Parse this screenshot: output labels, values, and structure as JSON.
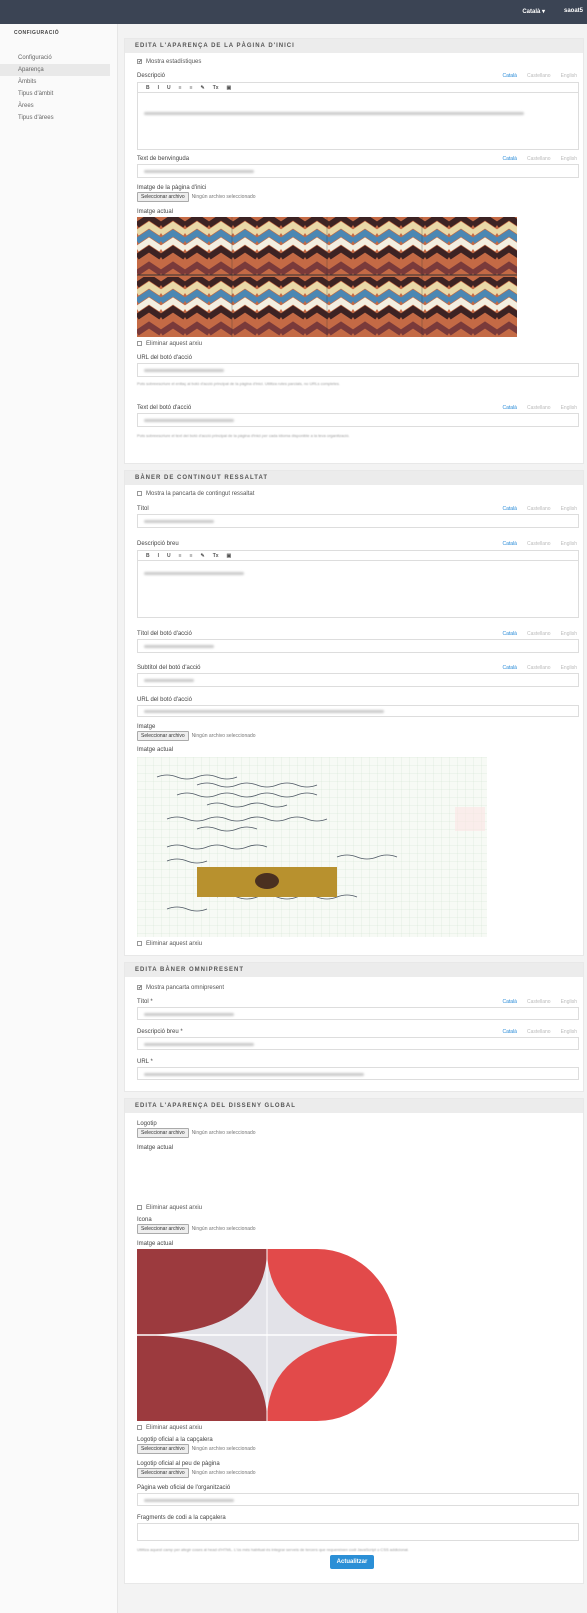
{
  "topbar": {
    "language": "Català ▾",
    "user": "saoat5"
  },
  "sidebar": {
    "title": "CONFIGURACIÓ",
    "items": [
      {
        "label": "Configuració"
      },
      {
        "label": "Aparença"
      },
      {
        "label": "Àmbits"
      },
      {
        "label": "Tipus d'àmbit"
      },
      {
        "label": "Àrees"
      },
      {
        "label": "Tipus d'àrees"
      }
    ]
  },
  "langs": {
    "ca": "Català",
    "es": "Castellano",
    "en": "English"
  },
  "file_input": {
    "button": "Seleccionar archivo",
    "none": "Ningún archivo seleccionado"
  },
  "common": {
    "current_image": "Imatge actual",
    "remove_image": "Eliminar aquest arxiu"
  },
  "home": {
    "header": "EDITA L'APARENÇA DE LA PÀGINA D'INICI",
    "show_stats": "Mostra estadístiques",
    "description_label": "Descripció",
    "welcome_label": "Text de benvinguda",
    "home_image_label": "Imatge de la pàgina d'inici",
    "cta_url_label": "URL del botó d'acció",
    "cta_url_help": "Pots sobreescriure el enllaç al botó d'acció principal de la pàgina d'inici. Utilitza rutes parcials, no URLs completes.",
    "cta_text_label": "Text del botó d'acció",
    "cta_text_help": "Pots sobreescriure el text del botó d'acció principal de la pàgina d'inici per cada idioma disponible a la teva organització."
  },
  "highlight": {
    "header": "BÀNER DE CONTINGUT RESSALTAT",
    "show": "Mostra la pancarta de contingut ressaltat",
    "title_label": "Títol",
    "short_desc_label": "Descripció breu",
    "cta_title_label": "Títol del botó d'acció",
    "cta_subtitle_label": "Subtítol del botó d'acció",
    "cta_url_label": "URL del botó d'acció",
    "image_label": "Imatge"
  },
  "omni": {
    "header": "EDITA BÀNER OMNIPRESENT",
    "show": "Mostra pancarta omnipresent",
    "title_label": "Títol *",
    "short_desc_label": "Descripció breu *",
    "url_label": "URL *"
  },
  "global": {
    "header": "EDITA L'APARENÇA DEL DISSENY GLOBAL",
    "logo_label": "Logotip",
    "icon_label": "Icona",
    "header_logo_label": "Logotip oficial a la capçalera",
    "footer_logo_label": "Logotip oficial al peu de pàgina",
    "official_site_label": "Pàgina web oficial de l'organització",
    "header_snippet_label": "Fragments de codi a la capçalera",
    "header_snippet_help": "Utilitza aquest camp per afegir coses al head d'HTML. L'ús més habitual és integrar serveis de tercers que requereixen codi JavaScript o CSS addicional."
  },
  "submit": "Actualitzar",
  "colors": {
    "accent": "#2b8fd6",
    "topbar": "#3b4454"
  }
}
